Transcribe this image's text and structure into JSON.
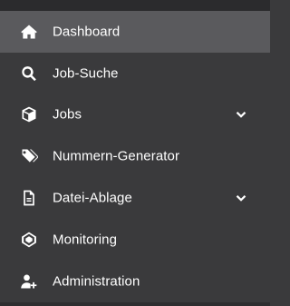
{
  "sidebar": {
    "items": [
      {
        "label": "Dashboard",
        "icon": "home-icon",
        "active": true,
        "expandable": false
      },
      {
        "label": "Job-Suche",
        "icon": "search-icon",
        "active": false,
        "expandable": false
      },
      {
        "label": "Jobs",
        "icon": "cube-icon",
        "active": false,
        "expandable": true
      },
      {
        "label": "Nummern-Generator",
        "icon": "tags-icon",
        "active": false,
        "expandable": false
      },
      {
        "label": "Datei-Ablage",
        "icon": "file-icon",
        "active": false,
        "expandable": true
      },
      {
        "label": "Monitoring",
        "icon": "monitoring-icon",
        "active": false,
        "expandable": false
      },
      {
        "label": "Administration",
        "icon": "user-plus-icon",
        "active": false,
        "expandable": false
      }
    ]
  },
  "colors": {
    "background": "#3a3a3c",
    "active_background": "#5a5a5d",
    "text": "#ffffff"
  }
}
